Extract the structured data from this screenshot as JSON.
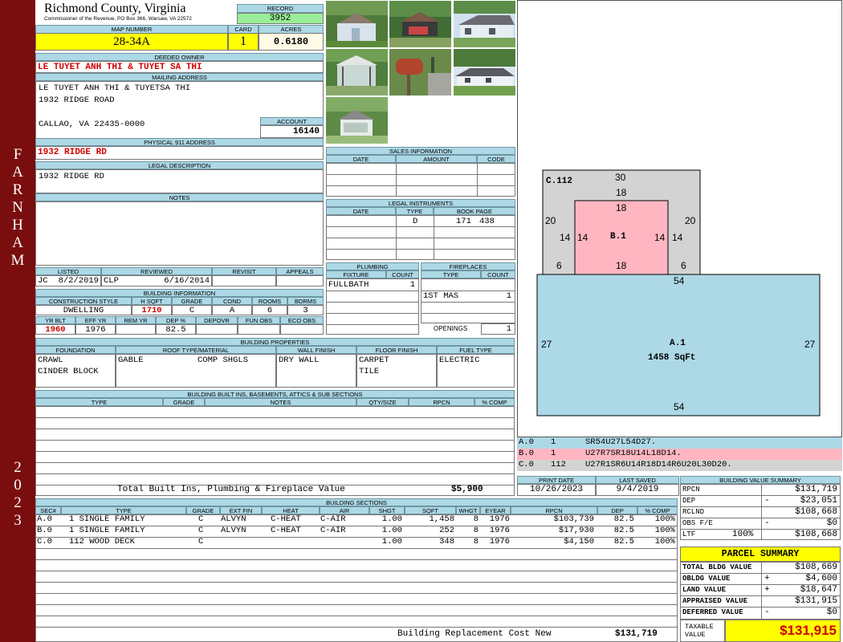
{
  "sidebar": {
    "district": "FARNHAM",
    "year": "2023"
  },
  "header": {
    "county": "Richmond County, Virginia",
    "commissioner": "Commissioner of the Revenue, PO Box 366, Warsaw, VA 22572"
  },
  "record": {
    "label": "RECORD",
    "value": "3952"
  },
  "map": {
    "label": "MAP NUMBER",
    "value": "28-34A"
  },
  "card": {
    "label": "CARD",
    "value": "1"
  },
  "acres": {
    "label": "ACRES",
    "value": "0.6180"
  },
  "owner": {
    "label": "DEEDED OWNER",
    "value": "LE TUYET ANH THI & TUYET SA THI"
  },
  "mailing": {
    "label": "MAILING ADDRESS",
    "line1": "LE TUYET ANH THI & TUYETSA THI",
    "line2": "1932 RIDGE ROAD",
    "line3": "CALLAO, VA 22435-0000"
  },
  "account": {
    "label": "ACCOUNT",
    "value": "16140"
  },
  "physical": {
    "label": "PHYSICAL 911 ADDRESS",
    "value": "1932 RIDGE RD"
  },
  "legal_desc": {
    "label": "LEGAL DESCRIPTION",
    "value": "1932 RIDGE RD"
  },
  "notes": {
    "label": "NOTES",
    "value": ""
  },
  "listing": {
    "listed_label": "LISTED",
    "reviewed_label": "REVIEWED",
    "revisit_label": "REVISIT",
    "appeals_label": "APPEALS",
    "listed_by": "JC",
    "listed_date": "8/2/2019",
    "reviewed_by": "CLP",
    "reviewed_date": "6/16/2014"
  },
  "building_info": {
    "label": "BUILDING INFORMATION",
    "h1": [
      "CONSTRUCTION STYLE",
      "H SQFT",
      "GRADE",
      "COND",
      "ROOMS",
      "BDRMS"
    ],
    "v1": [
      "DWELLING",
      "1710",
      "C",
      "A",
      "6",
      "3"
    ],
    "h2": [
      "YR BLT",
      "EFF YR",
      "REM YR",
      "DEP %",
      "DEPOVR",
      "FUN OBS",
      "ECO OBS"
    ],
    "v2": [
      "1960",
      "1976",
      "",
      "82.5",
      "",
      "",
      ""
    ]
  },
  "building_props": {
    "label": "BUILDING PROPERTIES",
    "h": [
      "FOUNDATION",
      "ROOF TYPE/MATERIAL",
      "WALL FINISH",
      "FLOOR FINISH",
      "FUEL TYPE"
    ],
    "foundation": [
      "CRAWL",
      "CINDER BLOCK"
    ],
    "roof_type": "GABLE",
    "roof_material": "COMP SHGLS",
    "wall": "DRY WALL",
    "floor": [
      "CARPET",
      "TILE"
    ],
    "fuel": "ELECTRIC"
  },
  "builtins": {
    "label": "BUILDING BUILT INS, BASEMENTS, ATTICS & SUB SECTIONS",
    "h": [
      "TYPE",
      "GRADE",
      "NOTES",
      "QTY/SIZE",
      "RPCN",
      "% COMP"
    ],
    "total_label": "Total Built Ins, Plumbing & Fireplace Value",
    "total_value": "$5,900"
  },
  "sales": {
    "label": "SALES INFORMATION",
    "h": [
      "DATE",
      "AMOUNT",
      "CODE"
    ]
  },
  "legal_inst": {
    "label": "LEGAL INSTRUMENTS",
    "h": [
      "DATE",
      "TYPE",
      "BOOK PAGE"
    ],
    "type": "D",
    "book": "171",
    "page": "438"
  },
  "plumbing": {
    "label": "PLUMBING",
    "h": [
      "FIXTURE",
      "COUNT"
    ],
    "fixture": "FULLBATH",
    "count": "1"
  },
  "fireplaces": {
    "label": "FIREPLACES",
    "h": [
      "TYPE",
      "COUNT"
    ],
    "type": "1ST MAS",
    "count": "1",
    "openings_label": "OPENINGS",
    "openings": "1"
  },
  "sketch": {
    "c_label": "C.112",
    "c_top": "30",
    "c_sub": "18",
    "c_left": "20",
    "c_right": "20",
    "c_bl": "6",
    "c_br": "6",
    "b_label": "B.1",
    "b_top": "18",
    "b_bottom": "18",
    "b_ll": "14",
    "b_lr": "14",
    "b_rl": "14",
    "b_rr": "14",
    "a_label": "A.1",
    "a_area": "1458 SqFt",
    "a_top": "54",
    "a_bottom": "54",
    "a_left": "27",
    "a_right": "27",
    "color_a": "#add8e6",
    "color_b": "#ffb6c1",
    "color_c": "#d3d3d3"
  },
  "vectors": [
    {
      "sec": "A.0",
      "num": "1",
      "vec": "SR54U27L54D27."
    },
    {
      "sec": "B.0",
      "num": "1",
      "vec": "U27R7SR18U14L18D14."
    },
    {
      "sec": "C.0",
      "num": "112",
      "vec": "U27R1SR6U14R18D14R6U20L30D20."
    }
  ],
  "dates": {
    "print_label": "PRINT DATE",
    "print": "10/26/2023",
    "saved_label": "LAST SAVED",
    "saved": "9/4/2019"
  },
  "sections": {
    "label": "BUILDING SECTIONS",
    "h": [
      "SEC#",
      "TYPE",
      "GRADE",
      "EXT FIN",
      "HEAT",
      "AIR",
      "SHGT",
      "SQFT",
      "WHGT",
      "EYEAR",
      "RPCN",
      "DEP",
      "% COMP"
    ],
    "rows": [
      [
        "A.0",
        "1 SINGLE FAMILY",
        "C",
        "ALVYN",
        "C-HEAT",
        "C-AIR",
        "1.00",
        "1,458",
        "8",
        "1976",
        "$103,739",
        "82.5",
        "100%"
      ],
      [
        "B.0",
        "1 SINGLE FAMILY",
        "C",
        "ALVYN",
        "C-HEAT",
        "C-AIR",
        "1.00",
        "252",
        "8",
        "1976",
        "$17,930",
        "82.5",
        "100%"
      ],
      [
        "C.0",
        "112 WOOD DECK",
        "C",
        "",
        "",
        "",
        "1.00",
        "348",
        "8",
        "1976",
        "$4,150",
        "82.5",
        "100%"
      ]
    ],
    "cost_label": "Building Replacement Cost New",
    "cost_value": "$131,719"
  },
  "value_summary": {
    "label": "BUILDING VALUE SUMMARY",
    "rpcn_label": "RPCN",
    "rpcn": "$131,719",
    "dep_label": "DEP",
    "dep_sign": "-",
    "dep": "$23,051",
    "rclnd_label": "RCLND",
    "rclnd": "$108,668",
    "obs_label": "OBS F/E",
    "obs_sign": "-",
    "obs": "$0",
    "ltf_label": "LTF",
    "ltf_pct": "100%",
    "ltf": "$108,668"
  },
  "parcel": {
    "label": "PARCEL SUMMARY",
    "total_bldg_label": "TOTAL BLDG VALUE",
    "total_bldg": "$108,669",
    "obldg_label": "OBLDG VALUE",
    "obldg_sign": "+",
    "obldg": "$4,600",
    "land_label": "LAND VALUE",
    "land_sign": "+",
    "land": "$18,647",
    "appraised_label": "APPRAISED VALUE",
    "appraised": "$131,915",
    "deferred_label": "DEFERRED VALUE",
    "deferred_sign": "-",
    "deferred": "$0",
    "taxable_label1": "TAXABLE",
    "taxable_label2": "VALUE",
    "taxable": "$131,915"
  }
}
